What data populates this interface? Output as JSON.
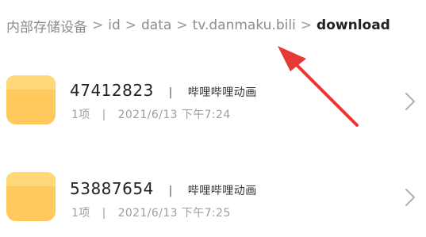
{
  "breadcrumb": {
    "items": [
      "内部存储设备",
      "id",
      "data",
      "tv.danmaku.bili",
      "download"
    ],
    "separator": ">"
  },
  "rows": [
    {
      "name": "47412823",
      "app": "哔哩哔哩动画",
      "count": "1项",
      "date": "2021/6/13",
      "time": "下午7:24"
    },
    {
      "name": "53887654",
      "app": "哔哩哔哩动画",
      "count": "1项",
      "date": "2021/6/13",
      "time": "下午7:25"
    }
  ],
  "meta_separator": "|",
  "icons": {
    "folder": "folder-icon",
    "chevron": "chevron-right-icon",
    "annotation": "red-arrow"
  },
  "colors": {
    "folder": "#FFC95E",
    "folder_shade": "#FFD877",
    "arrow": "#E53935"
  }
}
